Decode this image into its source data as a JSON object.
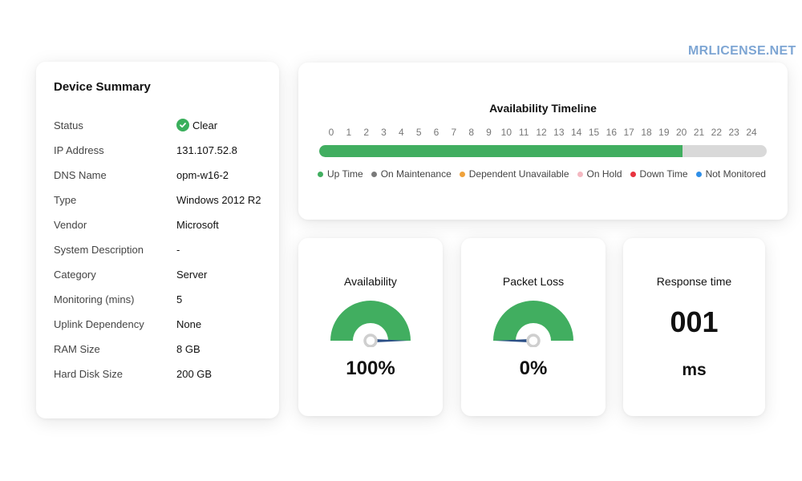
{
  "watermark": "MRLICENSE.NET",
  "device_summary": {
    "title": "Device Summary",
    "rows": [
      {
        "key": "Status",
        "value": "Clear"
      },
      {
        "key": "IP Address",
        "value": "131.107.52.8"
      },
      {
        "key": "DNS Name",
        "value": "opm-w16-2"
      },
      {
        "key": "Type",
        "value": "Windows 2012 R2"
      },
      {
        "key": "Vendor",
        "value": "Microsoft"
      },
      {
        "key": "System Description",
        "value": "-"
      },
      {
        "key": "Category",
        "value": "Server"
      },
      {
        "key": "Monitoring (mins)",
        "value": "5"
      },
      {
        "key": "Uplink Dependency",
        "value": "None"
      },
      {
        "key": "RAM Size",
        "value": "8 GB"
      },
      {
        "key": "Hard Disk Size",
        "value": "200 GB"
      }
    ],
    "status_icon": "check-circle-icon",
    "status_color": "#3aaf5c"
  },
  "timeline": {
    "title": "Availability Timeline",
    "hours": [
      "0",
      "1",
      "2",
      "3",
      "4",
      "5",
      "6",
      "7",
      "8",
      "9",
      "10",
      "11",
      "12",
      "13",
      "14",
      "15",
      "16",
      "17",
      "18",
      "19",
      "20",
      "21",
      "22",
      "23",
      "24"
    ],
    "uptime_until_hour": 19.5,
    "legend": [
      {
        "label": "Up Time",
        "color": "#41ae60"
      },
      {
        "label": "On Maintenance",
        "color": "#7a7a7a"
      },
      {
        "label": "Dependent Unavailable",
        "color": "#f0a23b"
      },
      {
        "label": "On Hold",
        "color": "#f4b8c1"
      },
      {
        "label": "Down Time",
        "color": "#e8343f"
      },
      {
        "label": "Not Monitored",
        "color": "#2f8fe8"
      }
    ]
  },
  "metrics": {
    "availability": {
      "title": "Availability",
      "value": "100%",
      "level": 1.0
    },
    "packet_loss": {
      "title": "Packet Loss",
      "value": "0%",
      "level": 0.0
    },
    "response_time": {
      "title": "Response time",
      "value": "001",
      "unit": "ms"
    }
  },
  "colors": {
    "gauge": "#41ae60",
    "needle": "#2b4f86"
  }
}
